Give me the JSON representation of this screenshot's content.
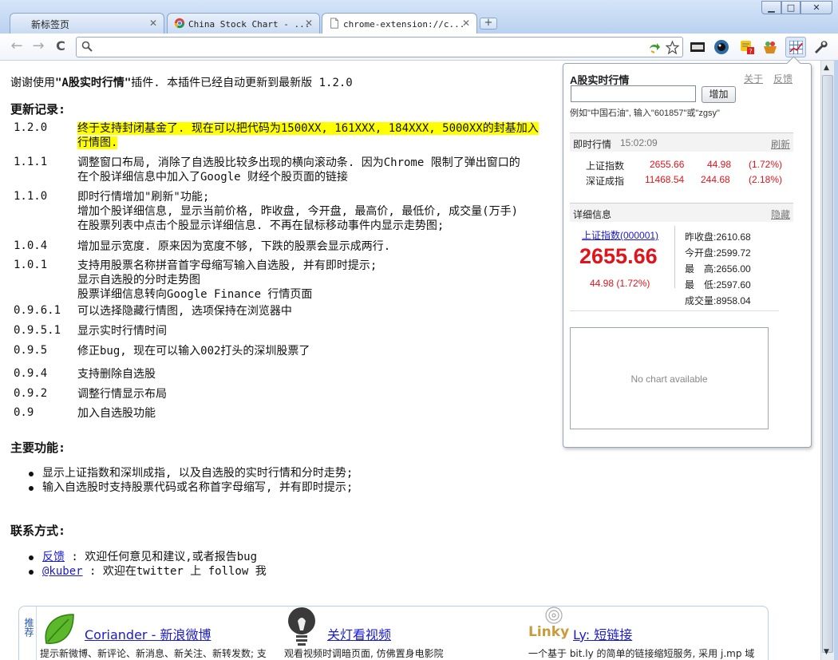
{
  "tabs": [
    {
      "label": "新标签页",
      "icon": "blank-page-icon"
    },
    {
      "label": "China Stock Chart - ...",
      "icon": "chrome-store-icon"
    },
    {
      "label": "chrome-extension://c...",
      "icon": "document-icon",
      "active": true
    }
  ],
  "window_controls": {
    "minimize": "▁",
    "maximize": "□",
    "close": "✕"
  },
  "toolbar": {
    "back": "←",
    "forward": "→",
    "reload": "C",
    "address": ""
  },
  "content": {
    "intro_prefix": "谢谢使用",
    "intro_name": "\"A股实时行情\"",
    "intro_suffix": "插件. 本插件已经自动更新到最新版 1.2.0",
    "changelog_heading": "更新记录:",
    "changelog": [
      {
        "ver": "1.2.0",
        "lines": [
          "终于支持封闭基金了. 现在可以把代码为1500XX, 161XXX, 184XXX, 5000XX的封基加入",
          "行情图."
        ]
      },
      {
        "ver": "1.1.1",
        "lines": [
          "调整窗口布局, 消除了自选股比较多出现的横向滚动条. 因为Chrome 限制了弹出窗口的",
          "在个股详细信息中加入了Google 财经个股页面的链接"
        ]
      },
      {
        "ver": "1.1.0",
        "lines": [
          "即时行情增加\"刷新\"功能;",
          "增加个股详细信息, 显示当前价格, 昨收盘, 今开盘, 最高价, 最低价, 成交量(万手)",
          "在股票列表中点击个股显示详细信息. 不再在鼠标移动事件内显示走势图;"
        ]
      },
      {
        "ver": "1.0.4",
        "lines": [
          "增加显示宽度. 原来因为宽度不够, 下跌的股票会显示成两行."
        ]
      },
      {
        "ver": "1.0.1",
        "lines": [
          "支持用股票名称拼音首字母缩写输入自选股, 并有即时提示;",
          "显示自选股的分时走势图",
          "股票详细信息转向Google Finance 行情页面"
        ]
      },
      {
        "ver": "0.9.6.1",
        "lines": [
          "可以选择隐藏行情图, 选项保持在浏览器中"
        ]
      },
      {
        "ver": "0.9.5.1",
        "lines": [
          "显示实时行情时间"
        ]
      },
      {
        "ver": "0.9.5",
        "lines": [
          "修正bug, 现在可以输入002打头的深圳股票了"
        ]
      },
      {
        "ver": "0.9.4",
        "lines": [
          "支持删除自选股"
        ]
      },
      {
        "ver": "0.9.2",
        "lines": [
          "调整行情显示布局"
        ]
      },
      {
        "ver": "0.9",
        "lines": [
          "加入自选股功能"
        ]
      }
    ],
    "features_heading": "主要功能:",
    "features": [
      "显示上证指数和深圳成指, 以及自选股的实时行情和分时走势;",
      "输入自选股时支持股票代码或名称首字母缩写, 并有即时提示;"
    ],
    "contact_heading": "联系方式:",
    "contacts": [
      {
        "link": "反馈",
        "text": " : 欢迎任何意见和建议,或者报告bug"
      },
      {
        "link": "@kuber",
        "text": " : 欢迎在twitter 上 follow 我"
      }
    ]
  },
  "recommend": {
    "side_label": "推荐",
    "items": [
      {
        "title": "Coriander - 新浪微博",
        "desc": "提示新微博、新评论、新消息、新关注、新转发数; 支",
        "icon": "leaf-icon"
      },
      {
        "title": "关灯看视频",
        "desc": "观看视频时调暗页面, 仿佛置身电影院",
        "icon": "lightbulb-icon"
      },
      {
        "title": "Ly: 短链接",
        "desc": "一个基于 bit.ly 的简单的链接缩短服务, 采用 j.mp 域",
        "icon": "linky-logo",
        "logo_text": "Linky"
      }
    ]
  },
  "popup": {
    "title": "A股实时行情",
    "about": "关于",
    "feedback": "反馈",
    "input_value": "",
    "add_button": "增加",
    "hint": "例如\"中国石油\", 输入\"601857\"或\"zgsy\"",
    "realtime": {
      "heading": "即时行情",
      "time": "15:02:09",
      "refresh": "刷新",
      "rows": [
        {
          "name": "上证指数",
          "price": "2655.66",
          "change": "44.98",
          "pct": "(1.72%)"
        },
        {
          "name": "深证成指",
          "price": "11468.54",
          "change": "244.68",
          "pct": "(2.18%)"
        }
      ]
    },
    "detail": {
      "heading": "详细信息",
      "hide": "隐藏",
      "link": "上证指数(000001)",
      "price": "2655.66",
      "change": "44.98 (1.72%)",
      "items": [
        {
          "label": "昨收盘:",
          "value": "2610.68"
        },
        {
          "label": "今开盘:",
          "value": "2599.72"
        },
        {
          "label": "最　高:",
          "value": "2656.00"
        },
        {
          "label": "最　低:",
          "value": "2597.60"
        },
        {
          "label": "成交量:",
          "value": "8958.04"
        }
      ]
    },
    "chart_placeholder": "No chart available"
  },
  "colors": {
    "accent_red": "#e0141a",
    "highlight": "#ffff00",
    "link": "#1a1ad4"
  }
}
